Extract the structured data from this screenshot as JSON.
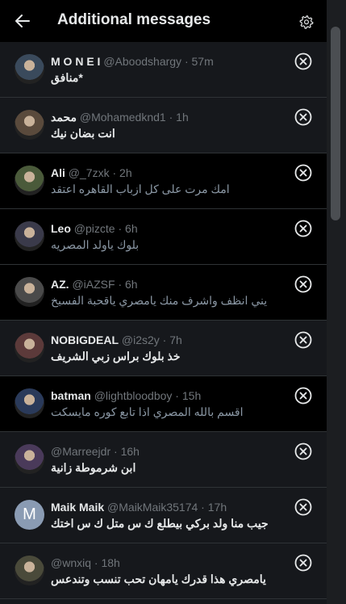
{
  "header": {
    "title": "Additional messages",
    "back_icon": "arrow-left-icon",
    "settings_icon": "gear-icon"
  },
  "colors": {
    "background": "#000000",
    "panel": "#16181c",
    "text": "#e7e9ea",
    "muted": "#71767b"
  },
  "messages": [
    {
      "name": "M O N E I",
      "handle": "@Aboodshargy",
      "time": "57m",
      "text": "منافق*",
      "style": "bold",
      "bg": "unread",
      "avatar": "avatar-photo"
    },
    {
      "name": "محمد",
      "handle": "@Mohamedknd1",
      "time": "1h",
      "text": "انت بضان نيك",
      "style": "bold",
      "bg": "unread",
      "avatar": "avatar-photo"
    },
    {
      "name": "Ali",
      "handle": "@_7zxk",
      "time": "2h",
      "text": "امك مرت على كل ازباب القاهره اعتقد",
      "style": "muted",
      "bg": "read",
      "avatar": "avatar-photo"
    },
    {
      "name": "Leo",
      "handle": "@pizcte",
      "time": "6h",
      "text": "بلوك ياولد المصريه",
      "style": "muted",
      "bg": "read",
      "avatar": "avatar-photo"
    },
    {
      "name": "AZ.",
      "handle": "@iAZSF",
      "time": "6h",
      "text": "يني انظف واشرف منك يامصري ياقحبة الفسيخ",
      "style": "muted",
      "bg": "read",
      "avatar": "avatar-photo"
    },
    {
      "name": "NOBIGDEAL",
      "handle": "@i2s2y",
      "time": "7h",
      "text": "خذ بلوك براس زبي الشريف",
      "style": "bold",
      "bg": "unread",
      "avatar": "avatar-photo"
    },
    {
      "name": "batman",
      "handle": "@lightbloodboy",
      "time": "15h",
      "text": "اقسم بالله المصري اذا تابع كوره مايسكت",
      "style": "muted",
      "bg": "read",
      "avatar": "avatar-photo"
    },
    {
      "name": "",
      "handle": "@Marreejdr",
      "time": "16h",
      "text": "ابن شرموطة زانية",
      "style": "bold",
      "bg": "unread",
      "avatar": "avatar-photo"
    },
    {
      "name": "Maik Maik",
      "handle": "@MaikMaik35174",
      "time": "17h",
      "text": "جيب منا ولد بركي بيطلع ك س متل ك س اختك",
      "style": "bold",
      "bg": "unread",
      "avatar": "M"
    },
    {
      "name": "",
      "handle": "@wnxiq",
      "time": "18h",
      "text": "يامصري هذا قدرك يامهان تحب تنسب وتندعس",
      "style": "bold",
      "bg": "unread",
      "avatar": "avatar-photo"
    }
  ]
}
